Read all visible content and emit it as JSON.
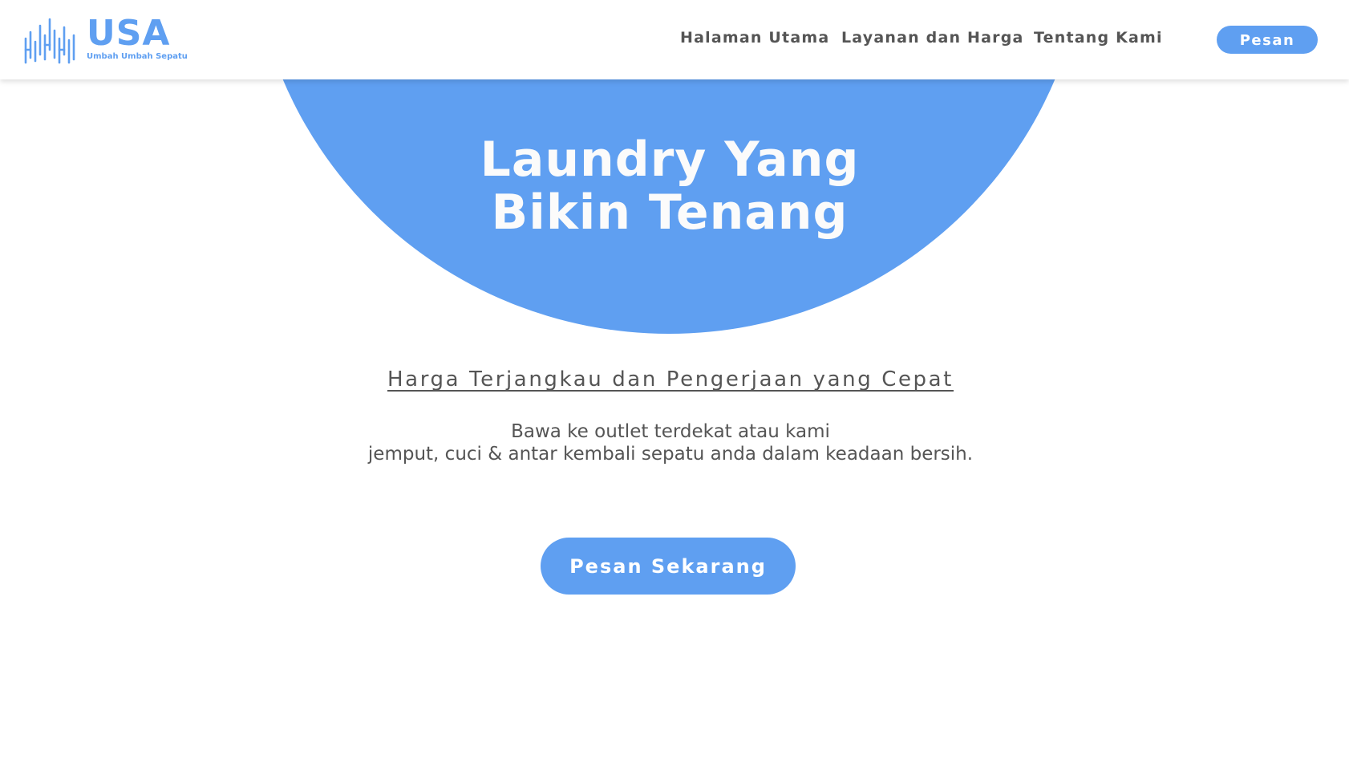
{
  "brand": {
    "name": "USA",
    "tagline": "Umbah Umbah Sepatu",
    "logo_icon": "waveform-bars-icon"
  },
  "nav": {
    "items": [
      {
        "label": "Halaman Utama"
      },
      {
        "label": "Layanan dan Harga"
      },
      {
        "label": "Tentang Kami"
      }
    ],
    "order_label": "Pesan"
  },
  "hero": {
    "title_line1": "Laundry Yang",
    "title_line2": "Bikin Tenang"
  },
  "content": {
    "subtitle": "Harga Terjangkau dan Pengerjaan yang Cepat",
    "description_line1": "Bawa ke outlet terdekat atau kami",
    "description_line2": "jemput, cuci & antar kembali sepatu anda dalam keadaan bersih.",
    "cta_label": "Pesan Sekarang"
  },
  "colors": {
    "accent": "#5f9ff1",
    "text": "#555555",
    "background": "#ffffff"
  }
}
